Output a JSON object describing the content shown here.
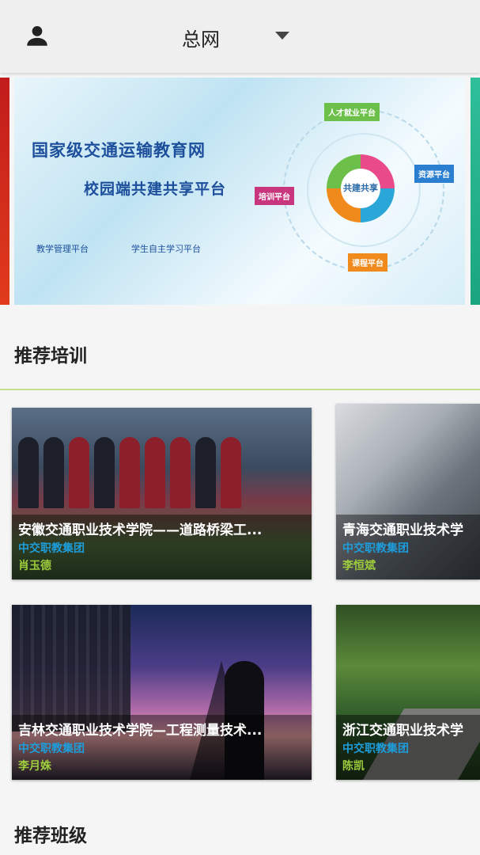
{
  "header": {
    "title": "总网",
    "user_icon": "user-icon",
    "dropdown_icon": "caret-down-icon"
  },
  "banner": {
    "title_line1": "国家级交通运输教育网",
    "title_line2": "校园端共建共享平台",
    "sub_left": "教学管理平台",
    "sub_right": "学生自主学习平台",
    "center": "共建共享",
    "node_top": "人才就业平台",
    "node_right": "资源平台",
    "node_left": "培训平台",
    "node_bottom": "课程平台"
  },
  "sections": {
    "training": "推荐培训",
    "classes": "推荐班级"
  },
  "cards": [
    {
      "title": "安徽交通职业技术学院——道路桥梁工...",
      "org": "中交职教集团",
      "teacher": "肖玉德"
    },
    {
      "title": "青海交通职业技术学",
      "org": "中交职教集团",
      "teacher": "李恒斌"
    },
    {
      "title": "吉林交通职业技术学院—工程测量技术...",
      "org": "中交职教集团",
      "teacher": "李月姝"
    },
    {
      "title": "浙江交通职业技术学",
      "org": "中交职教集团",
      "teacher": "陈凯"
    }
  ],
  "colors": {
    "org": "#1e9ddb",
    "teacher": "#9dcd3d",
    "divider": "#c9de8a"
  }
}
